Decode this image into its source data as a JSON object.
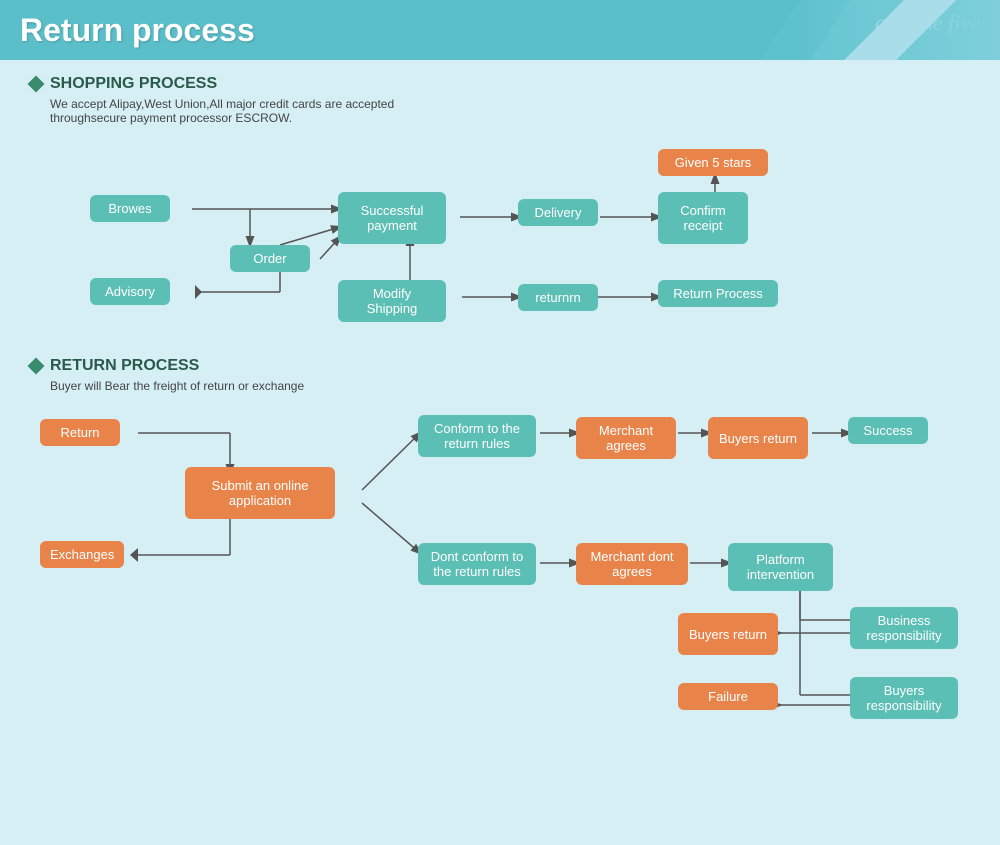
{
  "header": {
    "title": "Return process",
    "brand": "give me five"
  },
  "shopping": {
    "section_title": "SHOPPING PROCESS",
    "desc_line1": "We accept Alipay,West Union,All major credit cards are accepted",
    "desc_line2": "throughsecure payment processor ESCROW.",
    "boxes": {
      "browes": "Browes",
      "order": "Order",
      "advisory": "Advisory",
      "successful_payment": "Successful payment",
      "modify_shipping": "Modify Shipping",
      "delivery": "Delivery",
      "confirm_receipt": "Confirm receipt",
      "given_5_stars": "Given 5 stars",
      "returnrn": "returnrn",
      "return_process": "Return Process"
    }
  },
  "return": {
    "section_title": "RETURN PROCESS",
    "desc": "Buyer will Bear the freight of return or exchange",
    "boxes": {
      "return_btn": "Return",
      "submit_online": "Submit an online application",
      "exchanges": "Exchanges",
      "conform_rules": "Conform to the return rules",
      "dont_conform": "Dont conform to the return rules",
      "merchant_agrees": "Merchant agrees",
      "merchant_dont": "Merchant dont agrees",
      "buyers_return1": "Buyers return",
      "buyers_return2": "Buyers return",
      "success": "Success",
      "platform": "Platform intervention",
      "business_resp": "Business responsibility",
      "buyers_resp": "Buyers responsibility",
      "failure": "Failure"
    }
  }
}
